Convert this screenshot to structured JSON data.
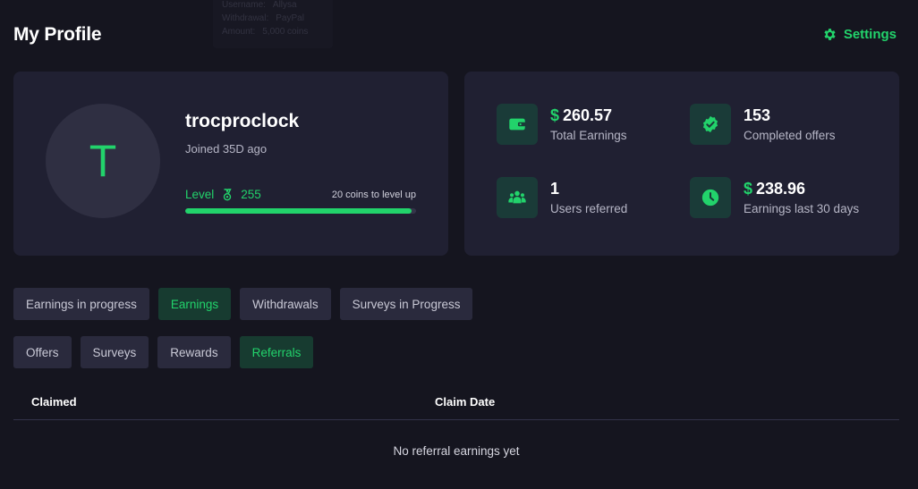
{
  "toast": {
    "username_label": "Username:",
    "username_value": "Allysa",
    "withdrawal_label": "Withdrawal:",
    "withdrawal_value": "PayPal",
    "amount_label": "Amount:",
    "amount_value": "5,000 coins"
  },
  "header": {
    "title": "My Profile",
    "settings_label": "Settings"
  },
  "profile": {
    "avatar_letter": "T",
    "username": "trocproclock",
    "joined": "Joined 35D ago",
    "level_label": "Level",
    "level_value": "255",
    "level_up_text": "20 coins to level up",
    "progress_fraction": 0.98
  },
  "stats": [
    {
      "currency": "$",
      "value": "260.57",
      "label": "Total Earnings",
      "icon": "wallet-icon"
    },
    {
      "currency": "",
      "value": "153",
      "label": "Completed offers",
      "icon": "check-badge-icon"
    },
    {
      "currency": "",
      "value": "1",
      "label": "Users referred",
      "icon": "users-icon"
    },
    {
      "currency": "$",
      "value": "238.96",
      "label": "Earnings last 30 days",
      "icon": "clock-icon"
    }
  ],
  "tabs_row1": [
    {
      "label": "Earnings in progress",
      "active": false
    },
    {
      "label": "Earnings",
      "active": true
    },
    {
      "label": "Withdrawals",
      "active": false
    },
    {
      "label": "Surveys in Progress",
      "active": false
    }
  ],
  "tabs_row2": [
    {
      "label": "Offers",
      "active": false
    },
    {
      "label": "Surveys",
      "active": false
    },
    {
      "label": "Rewards",
      "active": false
    },
    {
      "label": "Referrals",
      "active": true
    }
  ],
  "table": {
    "columns": [
      "Claimed",
      "Claim Date"
    ],
    "empty_message": "No referral earnings yet"
  },
  "colors": {
    "accent": "#22d36b",
    "background": "#15151f",
    "card": "#202032",
    "tab": "#2a2a3d",
    "tab_active": "#173b30"
  }
}
